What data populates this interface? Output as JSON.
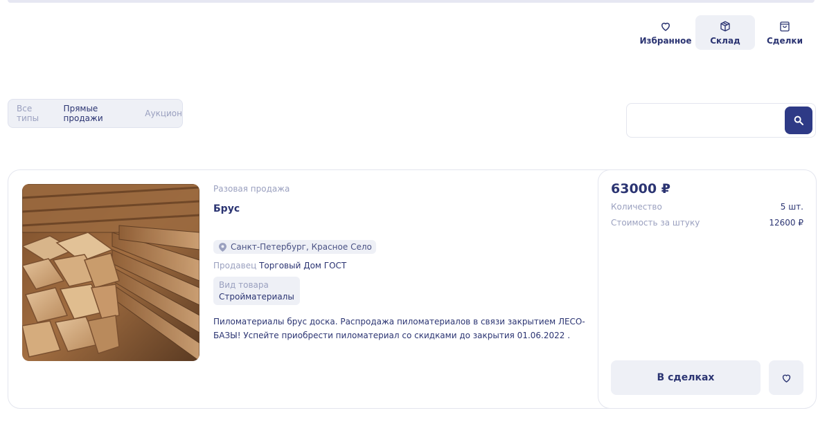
{
  "nav": {
    "favorites_label": "Избранное",
    "warehouse_label": "Склад",
    "deals_label": "Сделки",
    "favorites_icon": "heart-icon",
    "warehouse_icon": "box-icon",
    "deals_icon": "bag-icon"
  },
  "filter": {
    "all": "Все типы",
    "direct": "Прямые продажи",
    "auction": "Аукцион",
    "selected": "Прямые продажи"
  },
  "search": {
    "placeholder": "",
    "icon": "search-icon"
  },
  "listing": {
    "sale_type": "Разовая продажа",
    "title": "Брус",
    "location": "Санкт-Петербург, Красное Село",
    "seller_label": "Продавец",
    "seller": "Торговый Дом ГОСТ",
    "kind_label": "Вид товара",
    "kind": "Стройматериалы",
    "description": "Пиломатериалы брус доска. Распродажа пиломатериалов в связи закрытием ЛЕСО-БАЗЫ! Успейте приобрести пиломатериал со скидками до закрытия 01.06.2022 .",
    "price": "63000 ₽",
    "qty_label": "Количество",
    "qty": "5 шт.",
    "unit_price_label": "Стоимость за штуку",
    "unit_price": "12600 ₽",
    "deals_button": "В сделках"
  },
  "colors": {
    "accent": "#2e3a86",
    "text": "#2b3472",
    "muted": "#9aa0bf",
    "chip": "#eef0f6"
  }
}
